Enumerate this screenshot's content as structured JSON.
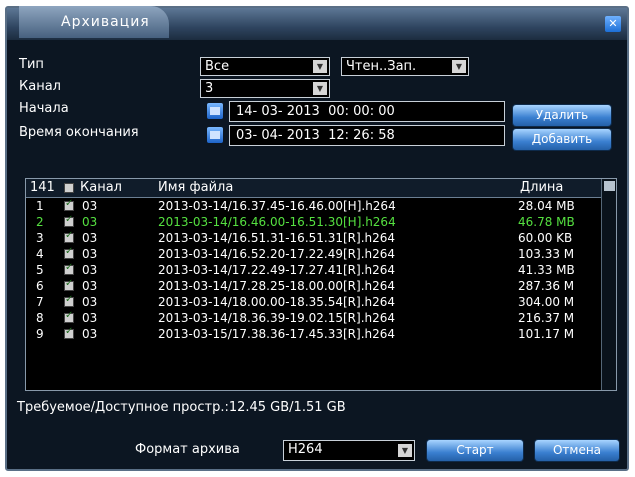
{
  "window": {
    "title": "Архивация"
  },
  "form": {
    "type_label": "Тип",
    "type_value": "Все",
    "mode_value": "Чтен..Зап.",
    "channel_label": "Канал",
    "channel_value": "3",
    "start_label": "Начала",
    "start_date": "14- 03- 2013",
    "start_time": "00: 00: 00",
    "end_label": "Время окончания",
    "end_date": "03- 04- 2013",
    "end_time": "12: 26: 58",
    "delete_button": "Удалить",
    "add_button": "Добавить"
  },
  "table": {
    "count": "141",
    "headers": {
      "channel": "Канал",
      "filename": "Имя файла",
      "length": "Длина"
    },
    "rows": [
      {
        "num": "1",
        "channel": "03",
        "filename": "2013-03-14/16.37.45-16.46.00[H].h264",
        "length": "28.04 MB",
        "highlight": false
      },
      {
        "num": "2",
        "channel": "03",
        "filename": "2013-03-14/16.46.00-16.51.30[H].h264",
        "length": "46.78 MB",
        "highlight": true
      },
      {
        "num": "3",
        "channel": "03",
        "filename": "2013-03-14/16.51.31-16.51.31[R].h264",
        "length": "60.00 KB",
        "highlight": false
      },
      {
        "num": "4",
        "channel": "03",
        "filename": "2013-03-14/16.52.20-17.22.49[R].h264",
        "length": "103.33 M",
        "highlight": false
      },
      {
        "num": "5",
        "channel": "03",
        "filename": "2013-03-14/17.22.49-17.27.41[R].h264",
        "length": "41.33 MB",
        "highlight": false
      },
      {
        "num": "6",
        "channel": "03",
        "filename": "2013-03-14/17.28.25-18.00.00[R].h264",
        "length": "287.36 M",
        "highlight": false
      },
      {
        "num": "7",
        "channel": "03",
        "filename": "2013-03-14/18.00.00-18.35.54[R].h264",
        "length": "304.00 M",
        "highlight": false
      },
      {
        "num": "8",
        "channel": "03",
        "filename": "2013-03-14/18.36.39-19.02.15[R].h264",
        "length": "216.37 M",
        "highlight": false
      },
      {
        "num": "9",
        "channel": "03",
        "filename": "2013-03-15/17.38.36-17.45.33[R].h264",
        "length": "101.17 M",
        "highlight": false
      }
    ]
  },
  "storage": {
    "text": "Требуемое/Доступное простр.:12.45 GB/1.51 GB"
  },
  "bottom": {
    "format_label": "Формат архива",
    "format_value": "H264",
    "start_button": "Старт",
    "cancel_button": "Отмена"
  },
  "colors": {
    "highlight_row": "#55e040",
    "button": "#3a7fd0"
  }
}
